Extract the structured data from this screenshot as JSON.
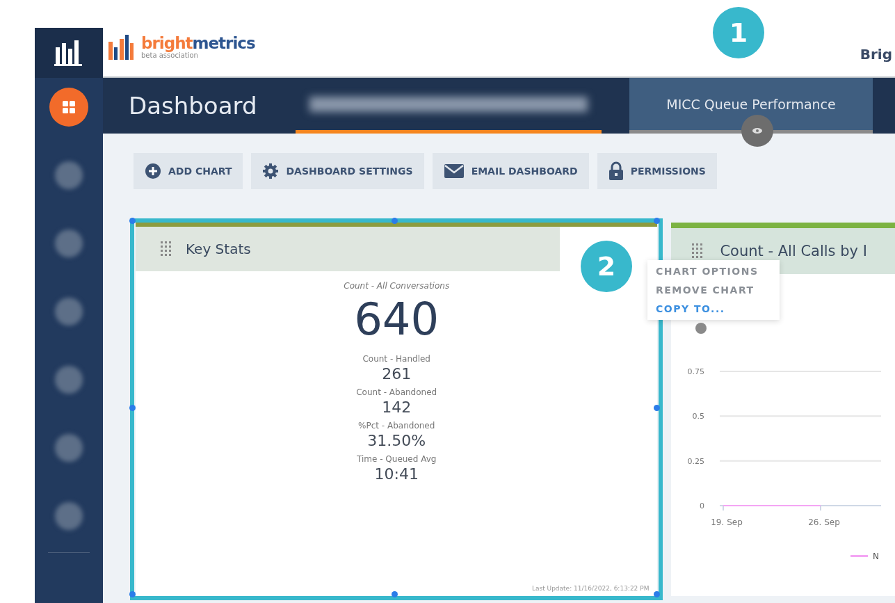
{
  "callouts": [
    {
      "number": "1"
    },
    {
      "number": "2"
    }
  ],
  "sidebar": {
    "items": [
      {
        "selected": true
      },
      {
        "selected": false
      },
      {
        "selected": false
      },
      {
        "selected": false
      },
      {
        "selected": false
      },
      {
        "selected": false
      },
      {
        "selected": false
      }
    ]
  },
  "logo": {
    "name_part_1": "bright",
    "name_part_2": "metrics",
    "tagline": "beta association"
  },
  "account": {
    "label": "Brig"
  },
  "header": {
    "title": "Dashboard"
  },
  "tabs": [
    {
      "kind": "redacted",
      "selected": true
    },
    {
      "kind": "text",
      "label": "MICC Queue Performance",
      "selected": false
    }
  ],
  "toolbar": [
    {
      "kind": "add",
      "label": "ADD CHART"
    },
    {
      "kind": "settings",
      "label": "DASHBOARD SETTINGS"
    },
    {
      "kind": "email",
      "label": "EMAIL DASHBOARD"
    },
    {
      "kind": "lock",
      "label": "PERMISSIONS"
    }
  ],
  "key_stats": {
    "title": "Key Stats",
    "stats": [
      {
        "kind": "primary",
        "label": "Count - All Conversations",
        "value": "640"
      },
      {
        "kind": "secondary",
        "label": "Count - Handled",
        "value": "261"
      },
      {
        "kind": "secondary",
        "label": "Count - Abandoned",
        "value": "142"
      },
      {
        "kind": "secondary",
        "label": "%Pct - Abandoned",
        "value": "31.50%"
      },
      {
        "kind": "secondary",
        "label": "Time - Queued Avg",
        "value": "10:41"
      }
    ],
    "last_update": "Last Update: 11/16/2022, 6:13:22 PM"
  },
  "chart_menu": [
    {
      "label": "CHART OPTIONS",
      "selected": false
    },
    {
      "label": "REMOVE CHART",
      "selected": false
    },
    {
      "label": "COPY TO...",
      "selected": true
    }
  ],
  "calls_chart": {
    "title": "Count - All Calls by I",
    "chart_data": {
      "type": "line",
      "categories": [
        "19. Sep",
        "26. Sep"
      ],
      "yticks": [
        0,
        0.25,
        0.5,
        0.75
      ],
      "ylim": [
        0,
        0.75
      ],
      "series": [
        {
          "name": "N",
          "color": "#f4a6f4",
          "values": [
            0,
            0
          ]
        }
      ]
    }
  }
}
